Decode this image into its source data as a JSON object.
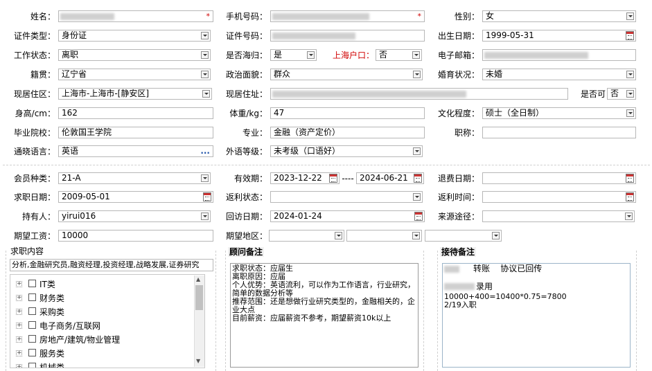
{
  "personal": {
    "name": {
      "label": "姓名：",
      "value": "",
      "required_mark": "*"
    },
    "mobile": {
      "label": "手机号码：",
      "value": "",
      "required_mark": "*"
    },
    "gender": {
      "label": "性别：",
      "value": "女"
    },
    "id_type": {
      "label": "证件类型：",
      "value": "身份证"
    },
    "id_number": {
      "label": "证件号码：",
      "value": ""
    },
    "birth_date": {
      "label": "出生日期：",
      "value": "1999-05-31"
    },
    "work_status": {
      "label": "工作状态：",
      "value": "离职"
    },
    "returnee": {
      "label": "是否海归：",
      "value": "是"
    },
    "shanghai_hukou": {
      "label": "上海户口：",
      "value": "否"
    },
    "email": {
      "label": "电子邮箱：",
      "value": ""
    },
    "native_place": {
      "label": "籍贯：",
      "value": "辽宁省"
    },
    "political": {
      "label": "政治面貌：",
      "value": "群众"
    },
    "marital": {
      "label": "婚育状况：",
      "value": "未婚"
    },
    "residence_area": {
      "label": "现居住区：",
      "value": "上海市-上海市-[静安区]"
    },
    "residence_addr": {
      "label": "现居住址：",
      "value": ""
    },
    "addr_public": {
      "label": "是否可",
      "value": "否"
    },
    "height": {
      "label": "身高/cm：",
      "value": "162"
    },
    "weight": {
      "label": "体重/kg：",
      "value": "47"
    },
    "education": {
      "label": "文化程度：",
      "value": "硕士（全日制）"
    },
    "school": {
      "label": "毕业院校：",
      "value": "伦敦国王学院"
    },
    "major": {
      "label": "专业：",
      "value": "金融（资产定价）"
    },
    "title": {
      "label": "职称：",
      "value": ""
    },
    "language": {
      "label": "通晓语言：",
      "value": "英语",
      "more": "..."
    },
    "lang_level": {
      "label": "外语等级：",
      "value": "未考级（口语好）"
    }
  },
  "membership": {
    "member_type": {
      "label": "会员种类：",
      "value": "21-A"
    },
    "valid_period": {
      "label": "有效期：",
      "start": "2023-12-22",
      "sep": "----",
      "end": "2024-06-21"
    },
    "refund_date": {
      "label": "退费日期：",
      "value": ""
    },
    "job_seek_date": {
      "label": "求职日期：",
      "value": "2009-05-01"
    },
    "rebate_status": {
      "label": "返利状态：",
      "value": ""
    },
    "rebate_time": {
      "label": "返利时间：",
      "value": ""
    },
    "holder": {
      "label": "持有人：",
      "value": "yirui016"
    },
    "visit_date": {
      "label": "回访日期：",
      "value": "2024-01-24"
    },
    "source": {
      "label": "来源途径：",
      "value": ""
    },
    "expected_salary": {
      "label": "期望工资：",
      "value": "10000"
    },
    "expected_region": {
      "label": "期望地区：",
      "values": [
        "",
        "",
        ""
      ]
    }
  },
  "job_content": {
    "title": "求职内容",
    "summary": "分析,金融研究员,融资经理,投资经理,战略发展,证券研究",
    "tree": [
      "IT类",
      "财务类",
      "采购类",
      "电子商务/互联网",
      "房地产/建筑/物业管理",
      "服务类",
      "机械类"
    ]
  },
  "consultant_note": {
    "title": "顾问备注",
    "text": "求职状态：应届生\n离职原因：应届\n个人优势：英语流利，可以作为工作语言，行业研究，简单的数据分析等\n推荐范围：还是想做行业研究类型的，金融相关的，企业大点\n目前薪资：应届薪资不参考，期望薪资10k以上"
  },
  "reception_note": {
    "title": "接待备注",
    "line1": "转账    协议已回传",
    "line2": "录用",
    "line3": "10000+400=10400*0.75=7800",
    "line4": "2/19入职"
  }
}
